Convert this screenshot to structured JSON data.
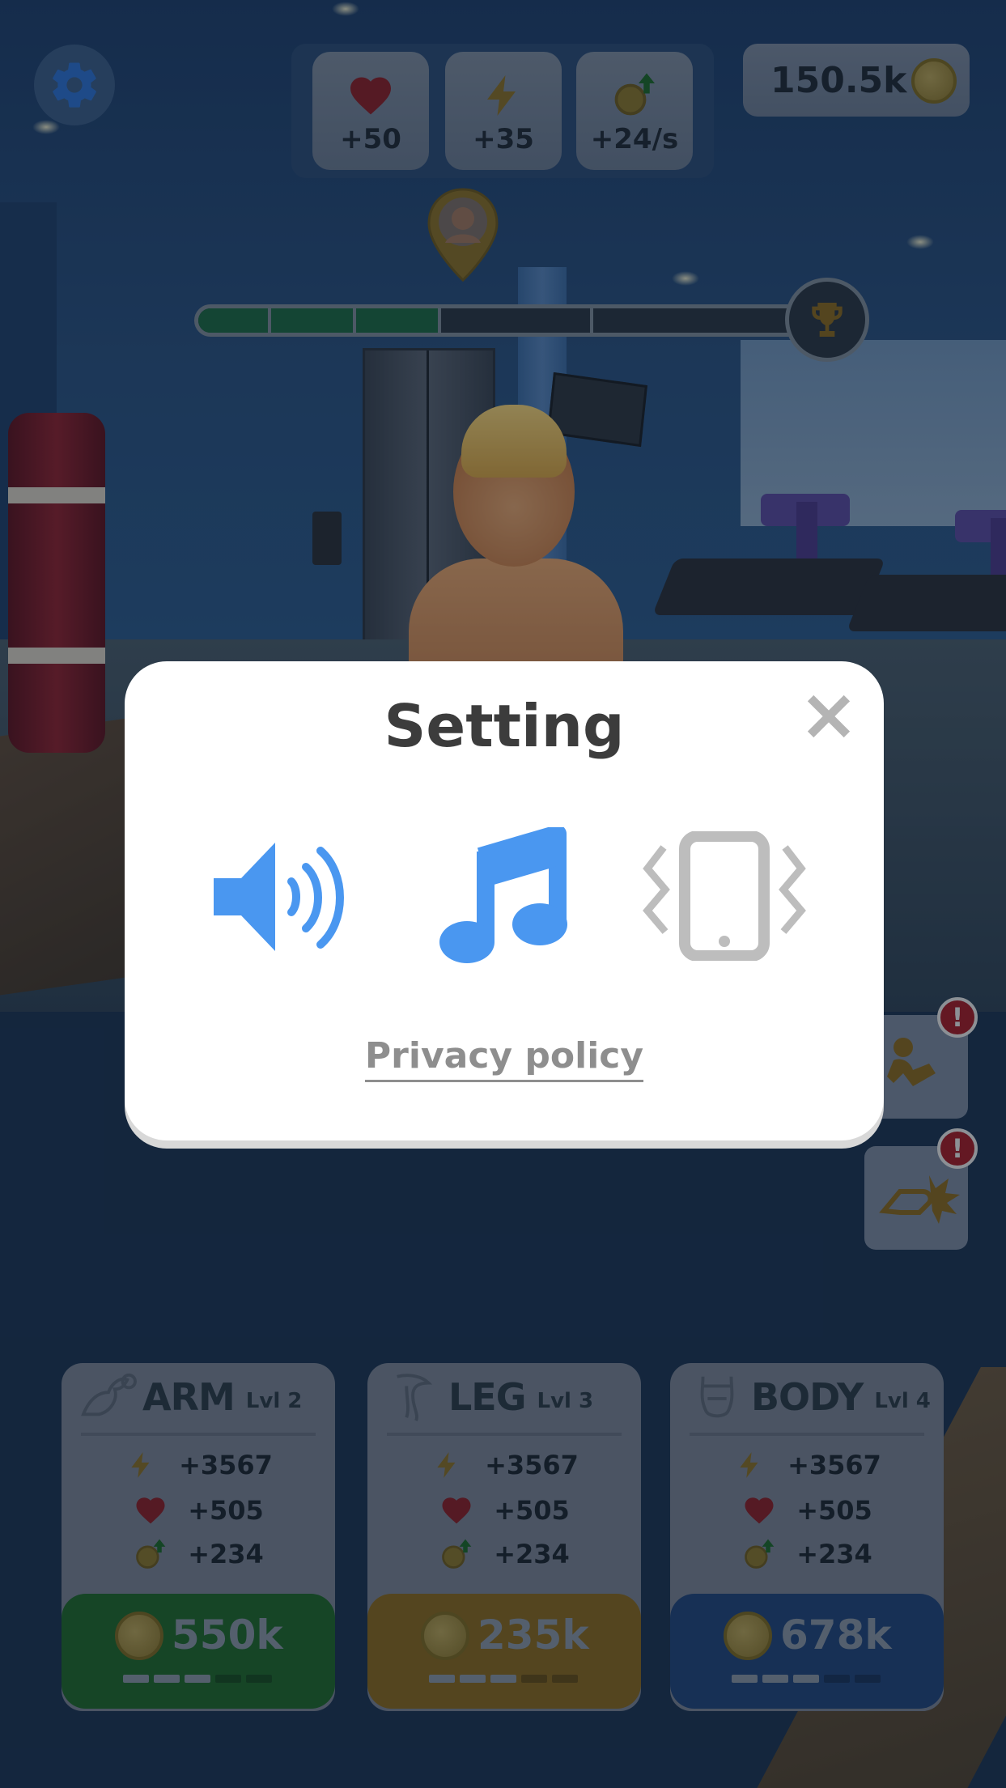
{
  "hud": {
    "stats": [
      {
        "icon": "heart-icon",
        "value": "+50"
      },
      {
        "icon": "lightning-icon",
        "value": "+35"
      },
      {
        "icon": "coin-up-icon",
        "value": "+24/s"
      }
    ],
    "coins": "150.5k"
  },
  "progress": {
    "filled_fraction": 0.4,
    "segments": 5,
    "filled_segments": 3
  },
  "upgrades": [
    {
      "title": "ARM",
      "level": "Lvl 2",
      "energy": "+3567",
      "health": "+505",
      "income": "+234",
      "price": "550k",
      "button_color": "#1f6a2c",
      "progress_filled": 3,
      "progress_total": 5
    },
    {
      "title": "LEG",
      "level": "Lvl 3",
      "energy": "+3567",
      "health": "+505",
      "income": "+234",
      "price": "235k",
      "button_color": "#8a6a20",
      "progress_filled": 3,
      "progress_total": 5
    },
    {
      "title": "BODY",
      "level": "Lvl 4",
      "energy": "+3567",
      "health": "+505",
      "income": "+234",
      "price": "678k",
      "button_color": "#22467c",
      "progress_filled": 3,
      "progress_total": 5
    }
  ],
  "modal": {
    "title": "Setting",
    "options": [
      {
        "icon": "speaker-icon",
        "state": "on",
        "color": "#4a97f0"
      },
      {
        "icon": "music-note-icon",
        "state": "on",
        "color": "#4a97f0"
      },
      {
        "icon": "vibration-icon",
        "state": "off",
        "color": "#bdbdbd"
      }
    ],
    "privacy_link": "Privacy policy"
  },
  "side_buttons": [
    {
      "icon": "situps-icon",
      "alert": "!"
    },
    {
      "icon": "punch-icon",
      "alert": "!"
    }
  ]
}
